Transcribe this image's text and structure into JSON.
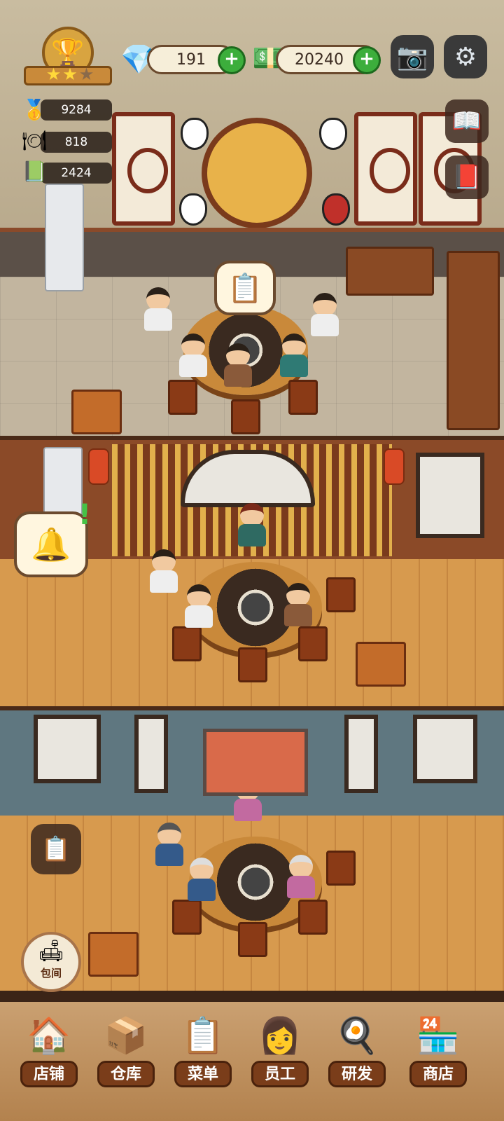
{
  "hud": {
    "gems": "191",
    "cash": "20240",
    "stat_gold": "9284",
    "stat_dishes": "818",
    "stat_menu": "2424",
    "rating_stars": 2,
    "rating_max": 3
  },
  "icons": {
    "trophy": "trophy-badge-icon",
    "gem": "gem-icon",
    "cash": "cash-icon",
    "camera": "camera-icon",
    "settings": "gear-icon",
    "book": "help-book-icon",
    "recipe": "recipe-book-icon",
    "clipboard": "order-clipboard-icon",
    "bell": "service-bell-icon",
    "task": "task-clipboard-icon"
  },
  "private_room_label": "包间",
  "nav": [
    {
      "label": "店铺",
      "icon": "shop-house-icon"
    },
    {
      "label": "仓库",
      "icon": "warehouse-boxes-icon"
    },
    {
      "label": "菜单",
      "icon": "menu-checklist-icon"
    },
    {
      "label": "员工",
      "icon": "staff-chef-icon"
    },
    {
      "label": "研发",
      "icon": "wok-research-icon"
    },
    {
      "label": "商店",
      "icon": "store-front-icon"
    }
  ],
  "colors": {
    "plus_green": "#3cae3c",
    "nav_label_bg": "#7a3d1a"
  }
}
